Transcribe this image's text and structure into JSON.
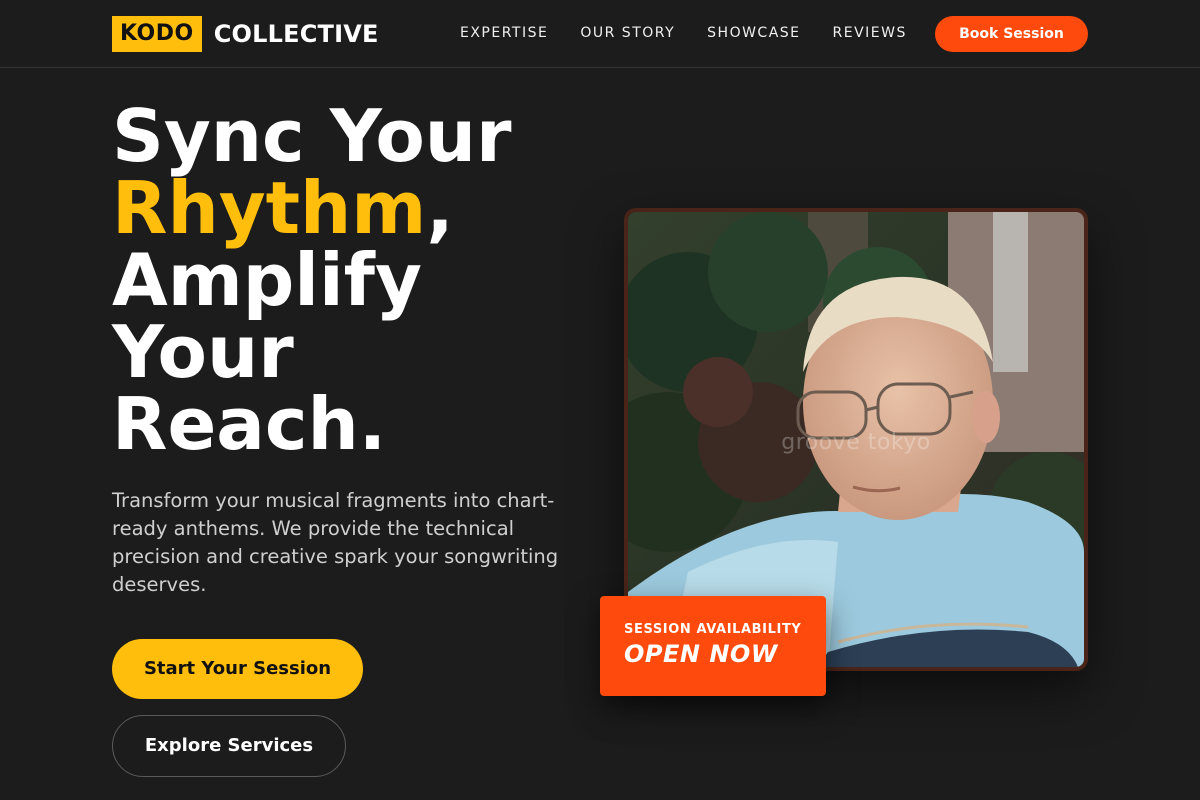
{
  "brand": {
    "badge": "KODO",
    "name": "COLLECTIVE",
    "accent_color": "#ffbe0b"
  },
  "nav": {
    "links": [
      "EXPERTISE",
      "OUR STORY",
      "SHOWCASE",
      "REVIEWS"
    ],
    "cta": "Book Session",
    "cta_color": "#ff4a0d"
  },
  "hero": {
    "headline_line1": "Sync Your",
    "headline_accent": "Rhythm",
    "headline_comma": ",",
    "headline_line3": "Amplify",
    "headline_line4": "Your",
    "headline_line5": "Reach.",
    "description": "Transform your musical fragments into chart-ready anthems. We provide the technical precision and creative spark your songwriting deserves.",
    "primary_button": "Start Your Session",
    "secondary_button": "Explore Services"
  },
  "photo": {
    "watermark": "groove tokyo",
    "subject_icon": "portrait-photo"
  },
  "availability": {
    "label": "SESSION AVAILABILITY",
    "value": "OPEN NOW"
  }
}
